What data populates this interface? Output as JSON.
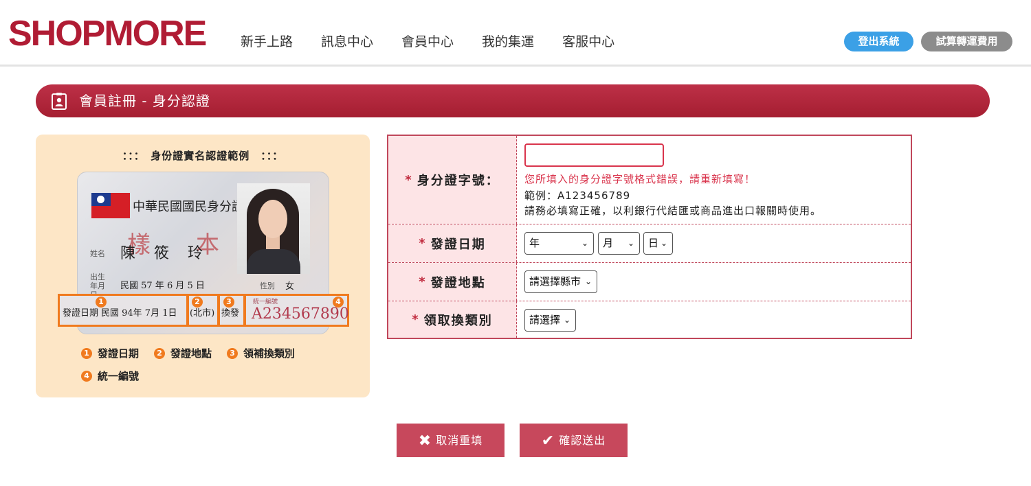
{
  "header": {
    "logo": "SHOPMORE",
    "nav": [
      "新手上路",
      "訊息中心",
      "會員中心",
      "我的集運",
      "客服中心"
    ],
    "logout_label": "登出系統",
    "fee_label": "試算轉運費用"
  },
  "title_bar": {
    "title": "會員註冊 - 身分認證",
    "icon": "id-badge-icon"
  },
  "example": {
    "title": "：：：　身份證實名認證範例　：：：",
    "card": {
      "header": "中華民國國民身分證",
      "watermark_left": "樣",
      "watermark_right": "本",
      "name_label": "姓名",
      "name": "陳 筱 玲",
      "birth_label": "出生年月日",
      "birth": "民國 57 年 6 月 5 日",
      "sex_label": "性別",
      "sex": "女",
      "issue_label": "發證日期",
      "issue_date": "民國 94年 7月 1日",
      "issue_place": "(北市)",
      "issue_type": "換發",
      "id_label": "統一編號",
      "id_number": "A234567890"
    },
    "legend": [
      {
        "num": "1",
        "label": "發證日期"
      },
      {
        "num": "2",
        "label": "發證地點"
      },
      {
        "num": "3",
        "label": "領補換類別"
      },
      {
        "num": "4",
        "label": "統一編號"
      }
    ]
  },
  "form": {
    "id_row": {
      "label": "身分證字號：",
      "value": "",
      "error": "您所填入的身分證字號格式錯誤，請重新填寫！",
      "hint_example": "範例：A123456789",
      "hint_note": "請務必填寫正確，以利銀行代結匯或商品進出口報關時使用。"
    },
    "date_row": {
      "label": "發證日期",
      "year": "年",
      "month": "月",
      "day": "日"
    },
    "place_row": {
      "label": "發證地點",
      "value": "請選擇縣市"
    },
    "type_row": {
      "label": "領取換類別",
      "value": "請選擇"
    }
  },
  "actions": {
    "cancel_label": "取消重填",
    "submit_label": "確認送出"
  },
  "colors": {
    "brand": "#b01c34",
    "title_bar": "#b02638",
    "error": "#d9344c",
    "button": "#c7485c",
    "logout": "#3ba0e6",
    "fee": "#8c8c8c"
  }
}
